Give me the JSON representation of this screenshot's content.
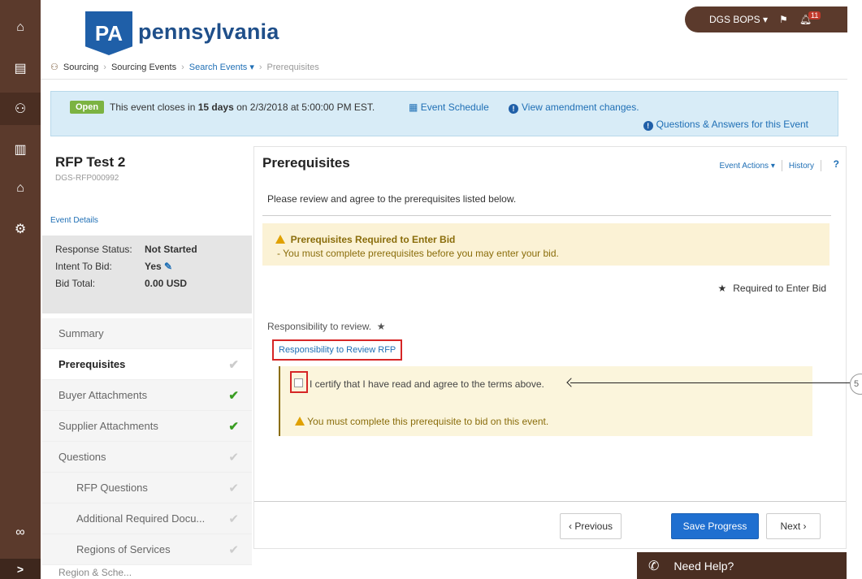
{
  "header": {
    "logo_mark": "PA",
    "logo_text": "pennsylvania",
    "user": "DGS BOPS",
    "notification_count": "11"
  },
  "rail": {
    "icons": [
      "home-icon",
      "documents-icon",
      "sourcing-icon",
      "analytics-icon",
      "vendor-icon",
      "settings-icon"
    ],
    "bottom_icon": "glasses-icon",
    "expand_label": ">"
  },
  "breadcrumb": {
    "items": [
      "Sourcing",
      "Sourcing Events",
      "Search Events",
      "Prerequisites"
    ]
  },
  "banner": {
    "status": "Open",
    "text_prefix": "This event closes in",
    "days": "15 days",
    "text_suffix": "on 2/3/2018 at 5:00:00 PM EST.",
    "schedule_link": "Event Schedule",
    "amendment_link": "View amendment changes.",
    "qa_link": "Questions & Answers for this Event"
  },
  "event": {
    "title": "RFP Test 2",
    "id": "DGS-RFP000992",
    "details_link": "Event Details",
    "response_status_label": "Response Status:",
    "response_status_value": "Not Started",
    "intent_label": "Intent To Bid:",
    "intent_value": "Yes",
    "bid_total_label": "Bid Total:",
    "bid_total_value": "0.00 USD"
  },
  "nav": [
    {
      "label": "Summary",
      "check": "",
      "active": false,
      "sub": false
    },
    {
      "label": "Prerequisites",
      "check": "✔",
      "active": true,
      "sub": false,
      "done": false
    },
    {
      "label": "Buyer Attachments",
      "check": "✔",
      "active": false,
      "sub": false,
      "done": true
    },
    {
      "label": "Supplier Attachments",
      "check": "✔",
      "active": false,
      "sub": false,
      "done": true
    },
    {
      "label": "Questions",
      "check": "✔",
      "active": false,
      "sub": false,
      "done": false
    },
    {
      "label": "RFP Questions",
      "check": "✔",
      "active": false,
      "sub": true,
      "done": false
    },
    {
      "label": "Additional Required Docu...",
      "check": "✔",
      "active": false,
      "sub": true,
      "done": false
    },
    {
      "label": "Regions of Services",
      "check": "✔",
      "active": false,
      "sub": true,
      "done": false
    }
  ],
  "nav_faded": "Region & Sche...",
  "main": {
    "title": "Prerequisites",
    "event_actions": "Event Actions",
    "history": "History",
    "help": "?",
    "intro": "Please review and agree to the prerequisites listed below.",
    "warn_title": "Prerequisites Required to Enter Bid",
    "warn_sub": "- You must complete prerequisites before you may enter your bid.",
    "required_legend": "Required to Enter Bid",
    "responsibility_label": "Responsibility to review.",
    "responsibility_link": "Responsibility to Review RFP",
    "certify_text": "I certify that I have read and agree to the terms above.",
    "certify_warning": "You must complete this prerequisite to bid on this event.",
    "btn_previous": "‹ Previous",
    "btn_save": "Save Progress",
    "btn_next": "Next ›"
  },
  "help": {
    "label": "Need Help?"
  },
  "callout": "5"
}
